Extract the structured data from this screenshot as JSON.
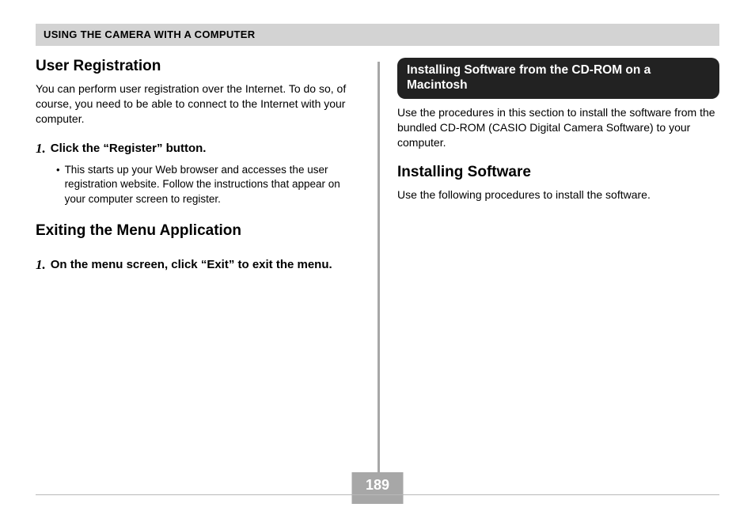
{
  "header": {
    "title": "USING THE CAMERA WITH A COMPUTER"
  },
  "left": {
    "userReg": {
      "title": "User Registration",
      "intro": "You can perform user registration over the Internet. To do so, of course, you need to be able to connect to the Internet with your computer.",
      "step1_num": "1.",
      "step1_text": "Click the “Register” button.",
      "bullet": "This starts up your Web browser and accesses the user registration website. Follow the instructions that appear on your computer screen to register."
    },
    "exiting": {
      "title": "Exiting the Menu Application",
      "step1_num": "1.",
      "step1_text": "On the menu screen, click “Exit” to exit the menu."
    }
  },
  "right": {
    "pill": "Installing Software from the CD-ROM on a Macintosh",
    "pill_body": "Use the procedures in this section to install the software from the bundled CD-ROM (CASIO Digital Camera Software) to your computer.",
    "installing": {
      "title": "Installing Software",
      "body": "Use the following procedures to install the software."
    }
  },
  "page_number": "189"
}
